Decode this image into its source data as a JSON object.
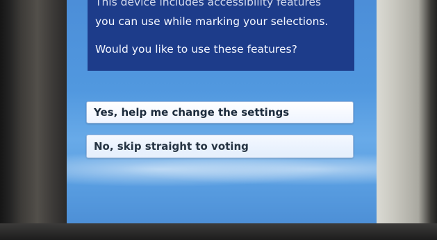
{
  "prompt": {
    "line1": "This device includes accessibility features",
    "line2": "you can use while marking your selections.",
    "question": "Would you like to use these features?"
  },
  "options": [
    {
      "label": "Yes, help me change the settings"
    },
    {
      "label": "No, skip straight to voting"
    }
  ]
}
